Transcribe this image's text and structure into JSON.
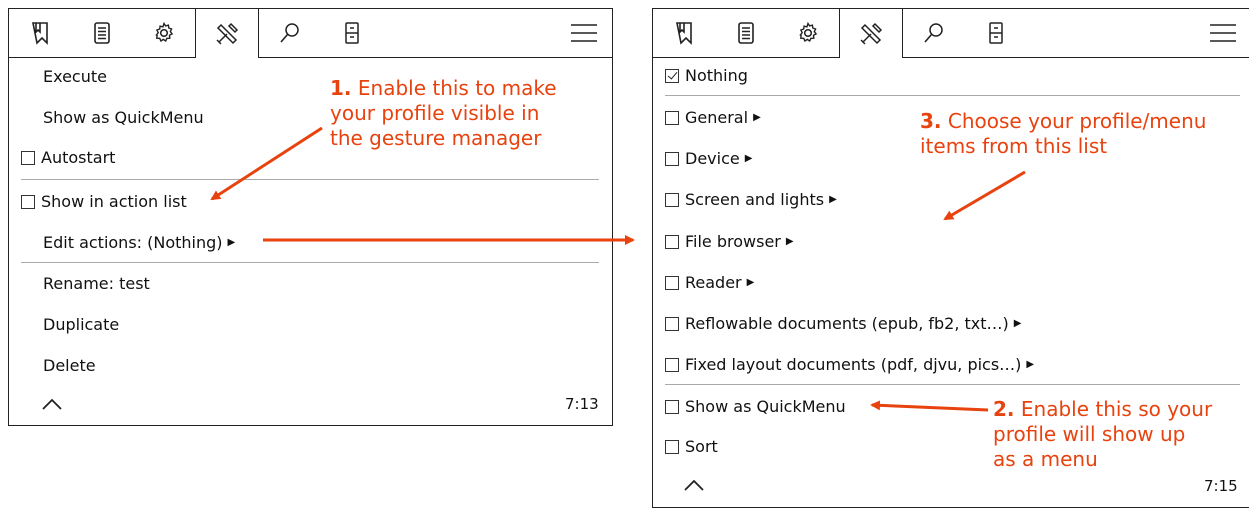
{
  "left_panel": {
    "tabs": [
      {
        "name": "bookmark-icon"
      },
      {
        "name": "document-list-icon"
      },
      {
        "name": "gear-icon"
      },
      {
        "name": "tools-icon",
        "active": true
      },
      {
        "name": "search-icon"
      },
      {
        "name": "filing-cabinet-icon"
      }
    ],
    "menu_icon": "hamburger-menu-icon",
    "items": {
      "execute": "Execute",
      "show_quickmenu": "Show as QuickMenu",
      "autostart": "Autostart",
      "show_action_list": "Show in action list",
      "edit_actions": "Edit actions: (Nothing)",
      "rename": "Rename: test",
      "duplicate": "Duplicate",
      "delete": "Delete"
    },
    "time": "7:13"
  },
  "right_panel": {
    "items": {
      "nothing": "Nothing",
      "general": "General",
      "device": "Device",
      "screen_lights": "Screen and lights",
      "file_browser": "File browser",
      "reader": "Reader",
      "reflowable": "Reflowable documents (epub, fb2, txt…)",
      "fixed_layout": "Fixed layout documents (pdf, djvu, pics…)",
      "show_quickmenu": "Show as QuickMenu",
      "sort": "Sort"
    },
    "time": "7:15"
  },
  "annotations": {
    "note1_num": "1.",
    "note1_line1": "Enable this to make",
    "note1_line2": "your profile visible in",
    "note1_line3": "the gesture manager",
    "note2_num": "2.",
    "note2_line1": "Enable this so your",
    "note2_line2": "profile will show up",
    "note2_line3": "as a menu",
    "note3_num": "3.",
    "note3_line1": "Choose your profile/menu",
    "note3_line2": "items from this list",
    "color": "#e8420f"
  }
}
